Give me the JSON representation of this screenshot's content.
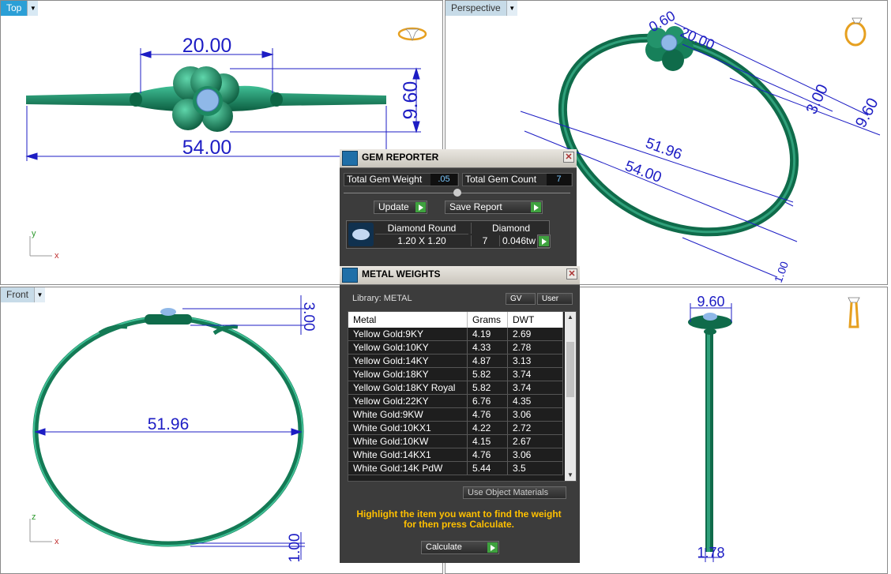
{
  "viewports": {
    "top": {
      "label": "Top"
    },
    "perspective": {
      "label": "Perspective"
    },
    "front": {
      "label": "Front"
    }
  },
  "dims": {
    "top_width": "20.00",
    "top_height": "9.60",
    "top_length": "54.00",
    "persp_a": "0.60",
    "persp_b": "20.00",
    "persp_c": "3.00",
    "persp_d": "9.60",
    "persp_e": "51.96",
    "persp_f": "54.00",
    "persp_g": "1.00",
    "front_a": "3.00",
    "front_b": "51.96",
    "front_c": "1.00",
    "right_a": "9.60",
    "right_b": "1.78"
  },
  "axes": {
    "x": "x",
    "y": "y",
    "z": "z"
  },
  "gem_reporter": {
    "title": "GEM REPORTER",
    "total_weight_label": "Total Gem Weight",
    "total_weight_value": ".05",
    "total_count_label": "Total Gem Count",
    "total_count_value": "7",
    "update_label": "Update",
    "save_label": "Save Report",
    "row": {
      "shape": "Diamond Round",
      "size": "1.20 X 1.20",
      "material": "Diamond",
      "count": "7",
      "weight": "0.046tw"
    }
  },
  "metal_weights": {
    "title": "METAL WEIGHTS",
    "library_label": "Library: METAL",
    "gv_label": "GV",
    "user_label": "User",
    "columns": [
      "Metal",
      "Grams",
      "DWT"
    ],
    "rows": [
      {
        "metal": "Yellow Gold:9KY",
        "grams": "4.19",
        "dwt": "2.69"
      },
      {
        "metal": "Yellow Gold:10KY",
        "grams": "4.33",
        "dwt": "2.78"
      },
      {
        "metal": "Yellow Gold:14KY",
        "grams": "4.87",
        "dwt": "3.13"
      },
      {
        "metal": "Yellow Gold:18KY",
        "grams": "5.82",
        "dwt": "3.74"
      },
      {
        "metal": "Yellow Gold:18KY Royal",
        "grams": "5.82",
        "dwt": "3.74"
      },
      {
        "metal": "Yellow Gold:22KY",
        "grams": "6.76",
        "dwt": "4.35"
      },
      {
        "metal": "White Gold:9KW",
        "grams": "4.76",
        "dwt": "3.06"
      },
      {
        "metal": "White Gold:10KX1",
        "grams": "4.22",
        "dwt": "2.72"
      },
      {
        "metal": "White Gold:10KW",
        "grams": "4.15",
        "dwt": "2.67"
      },
      {
        "metal": "White Gold:14KX1",
        "grams": "4.76",
        "dwt": "3.06"
      },
      {
        "metal": "White Gold:14K PdW",
        "grams": "5.44",
        "dwt": "3.5"
      }
    ],
    "use_object_label": "Use Object Materials",
    "hint": "Highlight the item you want to find the weight for then press Calculate.",
    "calculate_label": "Calculate"
  },
  "colors": {
    "metal": "#0f6b4a",
    "metal_light": "#3fbf95",
    "dimension": "#1d1dc4",
    "gem": "#8fb8e8",
    "hint": "#ffc000"
  }
}
